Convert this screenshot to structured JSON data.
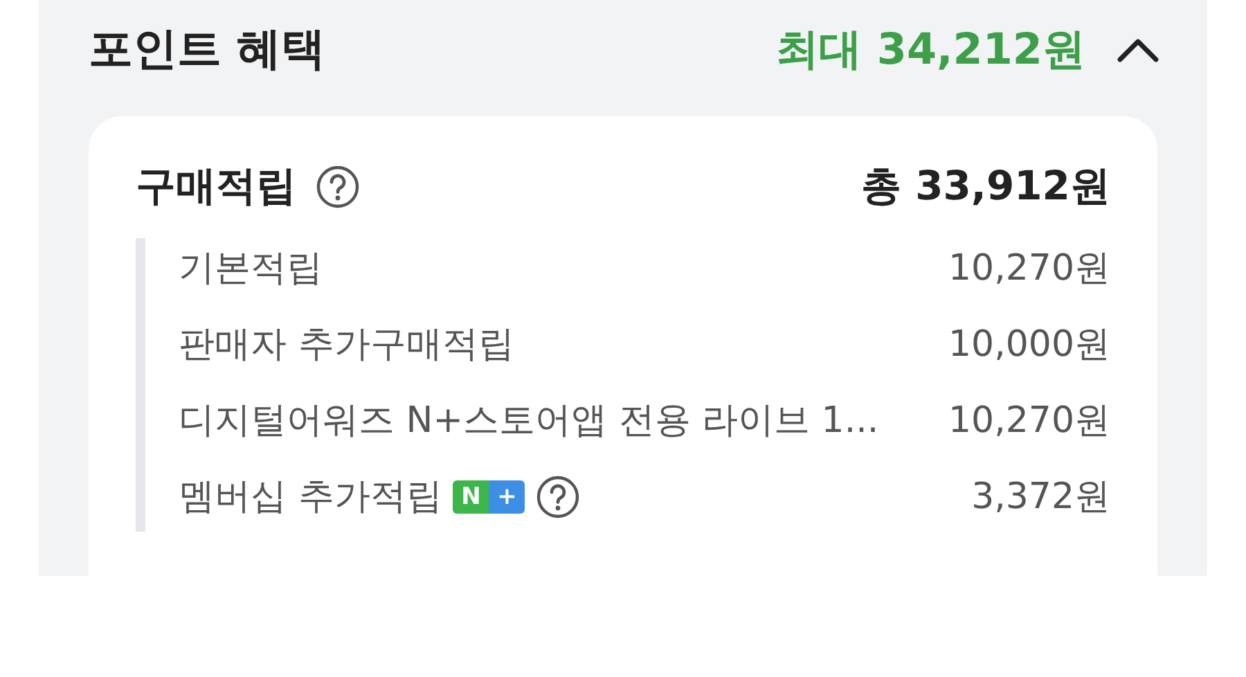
{
  "header": {
    "title": "포인트 혜택",
    "max_label": "최대 34,212원",
    "expanded": true
  },
  "card": {
    "title": "구매적립",
    "total": "총 33,912원",
    "rows": [
      {
        "kind": "plain",
        "label": "기본적립",
        "amount": "10,270원"
      },
      {
        "kind": "plain",
        "label": "판매자 추가구매적립",
        "amount": "10,000원"
      },
      {
        "kind": "plain",
        "label": "디지털어워즈 N+스토어앱 전용 라이브 1...",
        "amount": "10,270원"
      },
      {
        "kind": "membership",
        "label": "멤버십 추가적립",
        "badge": [
          "N",
          "+"
        ],
        "amount": "3,372원"
      }
    ]
  }
}
